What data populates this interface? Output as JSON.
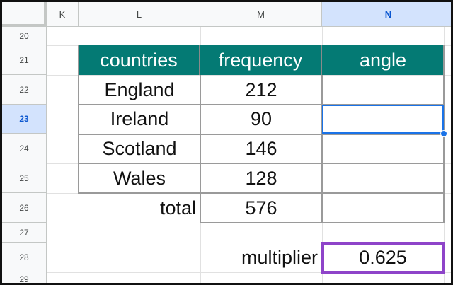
{
  "columns": [
    "K",
    "L",
    "M",
    "N"
  ],
  "rows": [
    "20",
    "21",
    "22",
    "23",
    "24",
    "25",
    "26",
    "27",
    "28",
    "29"
  ],
  "table": {
    "headers": [
      "countries",
      "frequency",
      "angle"
    ],
    "rows": [
      {
        "country": "England",
        "frequency": "212",
        "angle": ""
      },
      {
        "country": "Ireland",
        "frequency": "90",
        "angle": ""
      },
      {
        "country": "Scotland",
        "frequency": "146",
        "angle": ""
      },
      {
        "country": "Wales",
        "frequency": "128",
        "angle": ""
      }
    ],
    "total_label": "total",
    "total_value": "576"
  },
  "multiplier": {
    "label": "multiplier",
    "value": "0.625"
  },
  "selected_cell": "N23",
  "colors": {
    "header_fill": "#047a74",
    "selection": "#1a73e8",
    "highlight_box": "#8e44c9"
  }
}
